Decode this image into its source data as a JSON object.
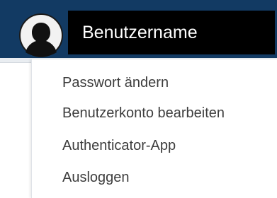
{
  "header": {
    "username": "Benutzername",
    "avatar_icon": "user-silhouette-icon",
    "bar_color": "#123a63"
  },
  "user_menu": {
    "items": [
      {
        "label": "Passwort ändern"
      },
      {
        "label": "Benutzerkonto bearbeiten"
      },
      {
        "label": "Authenticator-App"
      },
      {
        "label": "Ausloggen"
      }
    ]
  },
  "colors": {
    "header": "#123a63",
    "username_box": "#000000",
    "menu_text": "#3d3d3d",
    "menu_background": "#ffffff"
  }
}
